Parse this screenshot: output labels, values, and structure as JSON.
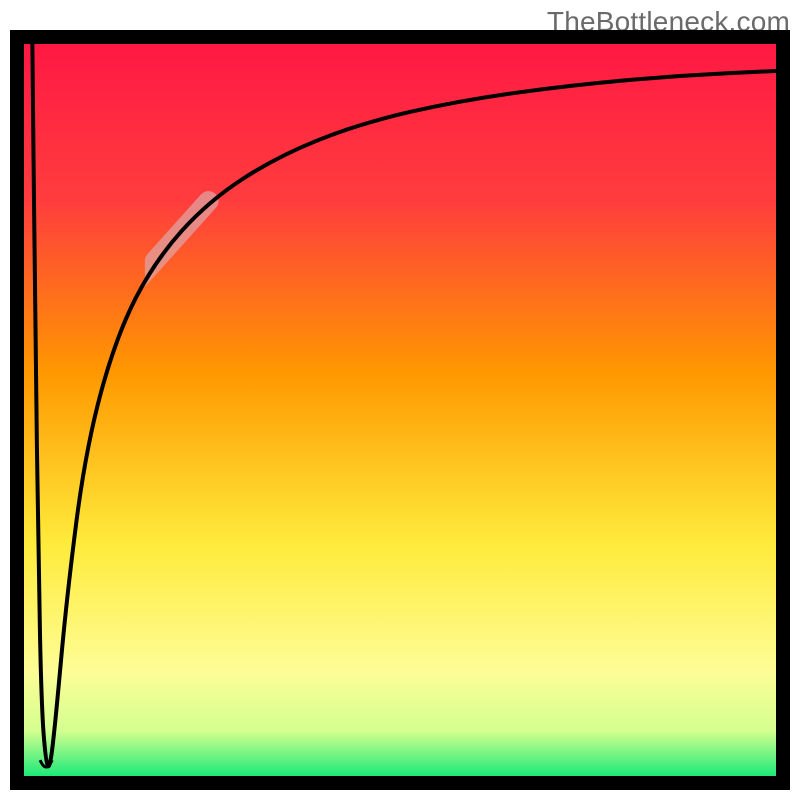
{
  "watermark": "TheBottleneck.com",
  "chart_data": {
    "type": "line",
    "title": "",
    "xlabel": "",
    "ylabel": "",
    "xlim": [
      0,
      100
    ],
    "ylim": [
      0,
      100
    ],
    "grid": false,
    "background": {
      "type": "vertical-gradient",
      "stops": [
        {
          "pos": 0.0,
          "color": "#ff1744"
        },
        {
          "pos": 0.22,
          "color": "#ff3d3d"
        },
        {
          "pos": 0.45,
          "color": "#ff9800"
        },
        {
          "pos": 0.68,
          "color": "#ffeb3b"
        },
        {
          "pos": 0.85,
          "color": "#fdfd96"
        },
        {
          "pos": 0.93,
          "color": "#d4ff8f"
        },
        {
          "pos": 1.0,
          "color": "#00e676"
        }
      ]
    },
    "series": [
      {
        "name": "bottleneck-curve",
        "color": "#000000",
        "points": [
          {
            "x": 2.0,
            "y": 99.5
          },
          {
            "x": 2.4,
            "y": 60.0
          },
          {
            "x": 2.8,
            "y": 30.0
          },
          {
            "x": 3.2,
            "y": 10.0
          },
          {
            "x": 3.8,
            "y": 2.5
          },
          {
            "x": 4.3,
            "y": 2.0
          },
          {
            "x": 5.0,
            "y": 8.0
          },
          {
            "x": 6.5,
            "y": 25.0
          },
          {
            "x": 9.0,
            "y": 45.0
          },
          {
            "x": 13.0,
            "y": 60.0
          },
          {
            "x": 18.0,
            "y": 70.0
          },
          {
            "x": 25.0,
            "y": 78.0
          },
          {
            "x": 34.0,
            "y": 84.0
          },
          {
            "x": 45.0,
            "y": 88.5
          },
          {
            "x": 58.0,
            "y": 91.5
          },
          {
            "x": 72.0,
            "y": 93.5
          },
          {
            "x": 86.0,
            "y": 94.8
          },
          {
            "x": 100.0,
            "y": 95.5
          }
        ]
      }
    ],
    "highlight_segment": {
      "series": "bottleneck-curve",
      "x_start": 18.0,
      "x_end": 25.0,
      "color": "#e0a0a0",
      "opacity": 0.75,
      "width": 20
    },
    "notch": {
      "x": 3.8,
      "y": 2.0
    }
  }
}
